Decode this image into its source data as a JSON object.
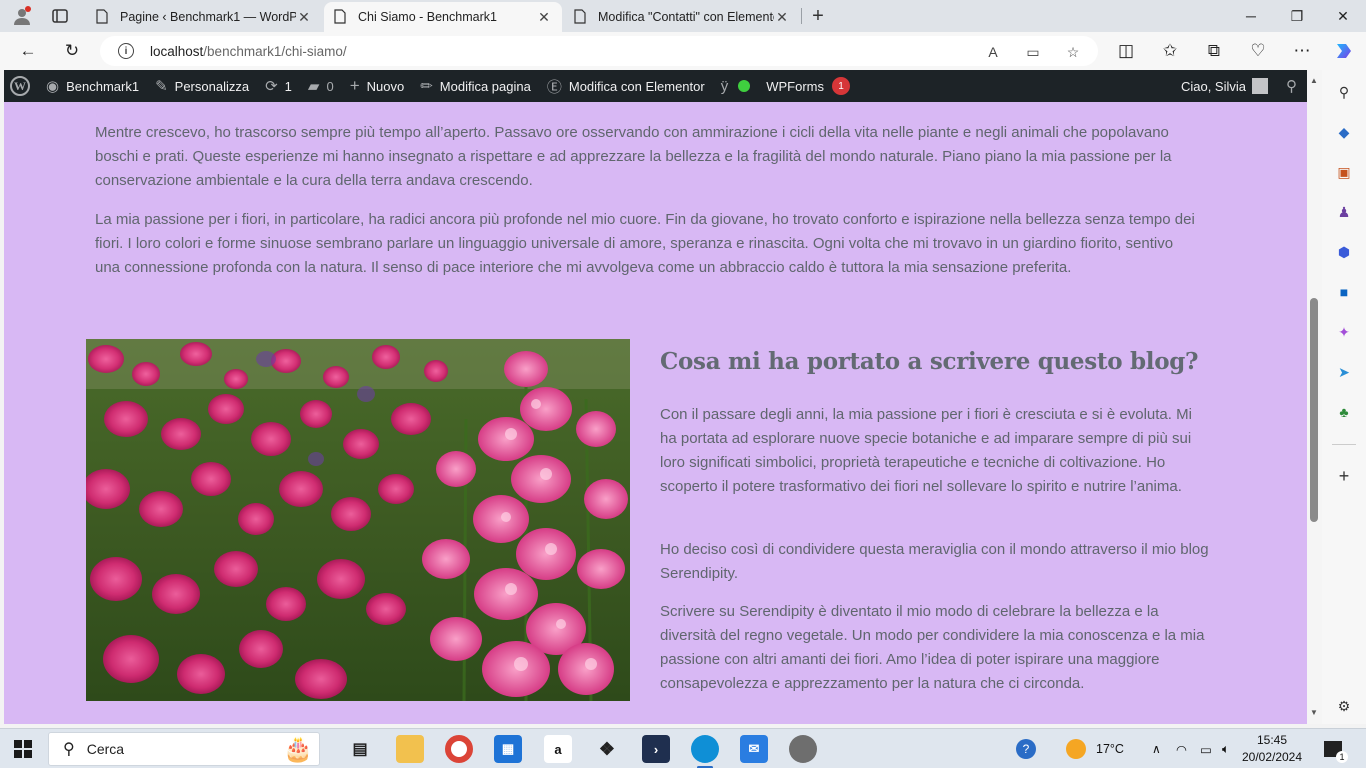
{
  "browser": {
    "tabs": [
      {
        "title": "Pagine ‹ Benchmark1 — WordPress",
        "active": false
      },
      {
        "title": "Chi Siamo - Benchmark1",
        "active": true
      },
      {
        "title": "Modifica \"Contatti\" con Elementor",
        "active": false
      }
    ],
    "url_host": "localhost",
    "url_path": "/benchmark1/chi-siamo/"
  },
  "adminbar": {
    "site": "Benchmark1",
    "customize": "Personalizza",
    "updates": "1",
    "comments": "0",
    "new": "Nuovo",
    "edit_page": "Modifica pagina",
    "edit_elementor": "Modifica con Elementor",
    "wpforms": "WPForms",
    "wpforms_badge": "1",
    "greeting": "Ciao, Silvia"
  },
  "content": {
    "para1": "Mentre crescevo, ho trascorso sempre più tempo all’aperto. Passavo ore osservando con ammirazione i cicli della vita nelle piante e negli animali che popolavano boschi e prati. Queste esperienze mi hanno insegnato a rispettare e ad apprezzare la bellezza e la fragilità del mondo naturale. Piano piano la mia passione per la conservazione ambientale e la cura della terra andava crescendo.",
    "para2": "La mia passione per i fiori, in particolare, ha radici ancora più profonde nel mio cuore. Fin da giovane, ho trovato conforto e ispirazione nella bellezza senza tempo dei fiori. I loro colori e forme sinuose sembrano parlare un linguaggio universale di amore, speranza e rinascita. Ogni volta che mi trovavo in un giardino fiorito, sentivo una connessione profonda con la natura. Il senso di pace interiore che mi avvolgeva come un abbraccio caldo è tuttora la mia sensazione preferita.",
    "heading": "Cosa mi ha portato a scrivere questo blog?",
    "p3": "Con il passare degli anni, la mia passione per i fiori è cresciuta e si è evoluta. Mi ha portata ad esplorare nuove specie botaniche e ad imparare sempre di più sui loro significati simbolici, proprietà terapeutiche e tecniche di coltivazione. Ho scoperto il potere trasformativo dei fiori nel sollevare lo spirito e nutrire l’anima.",
    "p4": "Ho deciso così di condividere questa meraviglia con il mondo attraverso il mio blog Serendipity.",
    "p5": "Scrivere su Serendipity è diventato il mio modo di celebrare la bellezza e la diversità del regno vegetale. Un modo per condividere la mia conoscenza e la mia passione con altri amanti dei fiori. Amo l’idea di poter ispirare una maggiore consapevolezza e apprezzamento per la natura che ci circonda."
  },
  "taskbar": {
    "search_placeholder": "Cerca",
    "temperature": "17°C",
    "time": "15:45",
    "date": "20/02/2024",
    "notifications": "1"
  },
  "colors": {
    "page_bg": "#d8b8f4",
    "adminbar_bg": "#1d2327",
    "text": "#60666e"
  }
}
